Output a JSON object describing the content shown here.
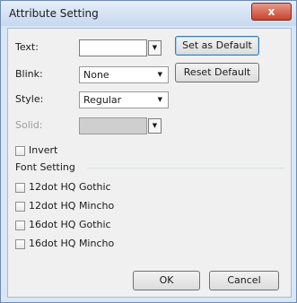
{
  "window": {
    "title": "Attribute Setting",
    "close_label": "x"
  },
  "fields": {
    "text_label": "Text:",
    "blink_label": "Blink:",
    "blink_value": "None",
    "style_label": "Style:",
    "style_value": "Regular",
    "solid_label": "Solid:"
  },
  "buttons": {
    "set_default": "Set as Default",
    "reset_default": "Reset Default",
    "ok": "OK",
    "cancel": "Cancel"
  },
  "invert": {
    "label": "Invert",
    "checked": false
  },
  "font_setting": {
    "title": "Font Setting",
    "options": [
      {
        "label": "12dot HQ Gothic",
        "checked": false
      },
      {
        "label": "12dot HQ Mincho",
        "checked": false
      },
      {
        "label": "16dot HQ Gothic",
        "checked": false
      },
      {
        "label": "16dot HQ Mincho",
        "checked": false
      }
    ]
  },
  "icons": {
    "dropdown": "chevron-down-icon",
    "close": "close-icon"
  }
}
